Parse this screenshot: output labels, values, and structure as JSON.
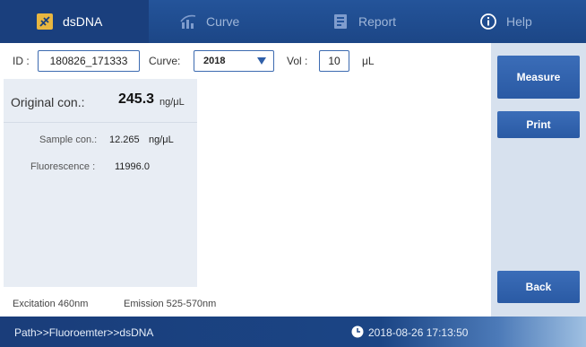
{
  "tabs": [
    {
      "label": "dsDNA",
      "icon": "dna-icon",
      "active": true
    },
    {
      "label": "Curve",
      "icon": "curve-icon",
      "active": false
    },
    {
      "label": "Report",
      "icon": "report-icon",
      "active": false
    },
    {
      "label": "Help",
      "icon": "info-icon",
      "active": false
    }
  ],
  "controls": {
    "id_label": "ID :",
    "id_value": "180826_171333",
    "curve_label": "Curve:",
    "curve_value": "2018",
    "vol_label": "Vol :",
    "vol_value": "10",
    "vol_unit": "μL"
  },
  "results": {
    "original_label": "Original con.:",
    "original_value": "245.3",
    "original_unit": "ng/μL",
    "sample_label": "Sample con.:",
    "sample_value": "12.265",
    "sample_unit": "ng/μL",
    "fluorescence_label": "Fluorescence :",
    "fluorescence_value": "11996.0"
  },
  "info": {
    "excitation": "Excitation 460nm",
    "emission": "Emission 525-570nm"
  },
  "buttons": {
    "measure": "Measure",
    "print": "Print",
    "back": "Back"
  },
  "status": {
    "path": "Path>>Fluoroemter>>dsDNA",
    "datetime": "2018-08-26 17:13:50"
  },
  "colors": {
    "accent": "#2a5aa4",
    "header": "#1c4686"
  }
}
